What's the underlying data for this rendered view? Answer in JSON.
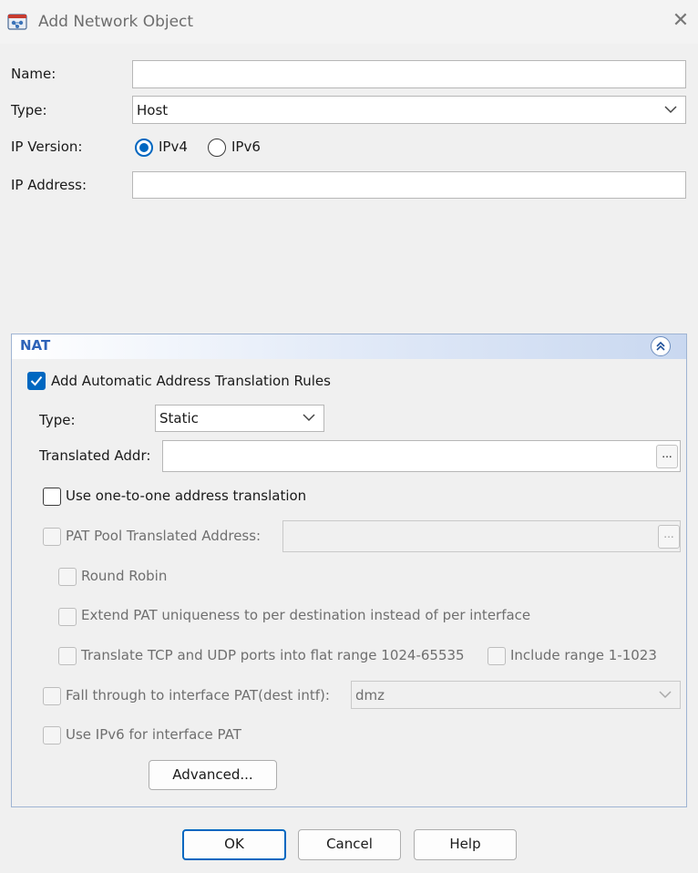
{
  "window": {
    "title": "Add Network Object",
    "app_icon": "network-object-icon",
    "close_icon": "close-icon"
  },
  "form": {
    "name_label": "Name:",
    "name_value": "",
    "type_label": "Type:",
    "type_value": "Host",
    "ip_version_label": "IP Version:",
    "ipv4_label": "IPv4",
    "ipv6_label": "IPv6",
    "ip_version_selected": "IPv4",
    "ip_address_label": "IP Address:",
    "ip_address_value": ""
  },
  "nat": {
    "title": "NAT",
    "auto_rules_label": "Add Automatic Address Translation Rules",
    "auto_rules_checked": true,
    "type_label": "Type:",
    "type_value": "Static",
    "translated_addr_label": "Translated Addr:",
    "translated_addr_value": "",
    "browse_label": "...",
    "one_to_one_label": "Use one-to-one address translation",
    "pat_pool_label": "PAT Pool Translated Address:",
    "round_robin_label": "Round Robin",
    "extend_pat_label": "Extend PAT uniqueness to per destination instead of per interface",
    "translate_tcp_udp_label": "Translate TCP and UDP ports into flat range 1024-65535",
    "include_range_label": "Include range 1-1023",
    "fall_through_label": "Fall through to interface PAT(dest intf):",
    "fall_through_value": "dmz",
    "use_ipv6_label": "Use IPv6 for interface PAT",
    "advanced_label": "Advanced..."
  },
  "buttons": {
    "ok": "OK",
    "cancel": "Cancel",
    "help": "Help"
  },
  "colors": {
    "accent": "#0067c0",
    "nat_header_text": "#2e63b8",
    "disabled_text": "#6f6f6f"
  }
}
